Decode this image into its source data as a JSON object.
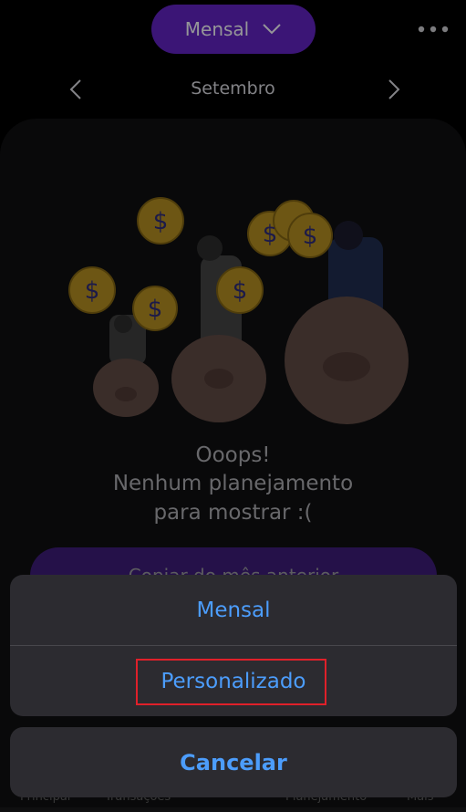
{
  "header": {
    "period_label": "Mensal",
    "month": "Setembro"
  },
  "empty_state": {
    "line1": "Ooops!",
    "line2": "Nenhum planejamento",
    "line3": "para mostrar :(",
    "copy_button": "Copiar do mês anterior"
  },
  "tabbar": {
    "items": [
      "Principal",
      "Transações",
      "Planejamento",
      "Mais"
    ]
  },
  "action_sheet": {
    "options": [
      "Mensal",
      "Personalizado"
    ],
    "cancel": "Cancelar",
    "highlighted_option": "Personalizado"
  },
  "colors": {
    "accent": "#5b21b6",
    "action_blue": "#4c9dfc",
    "highlight_border": "#e0202a"
  }
}
